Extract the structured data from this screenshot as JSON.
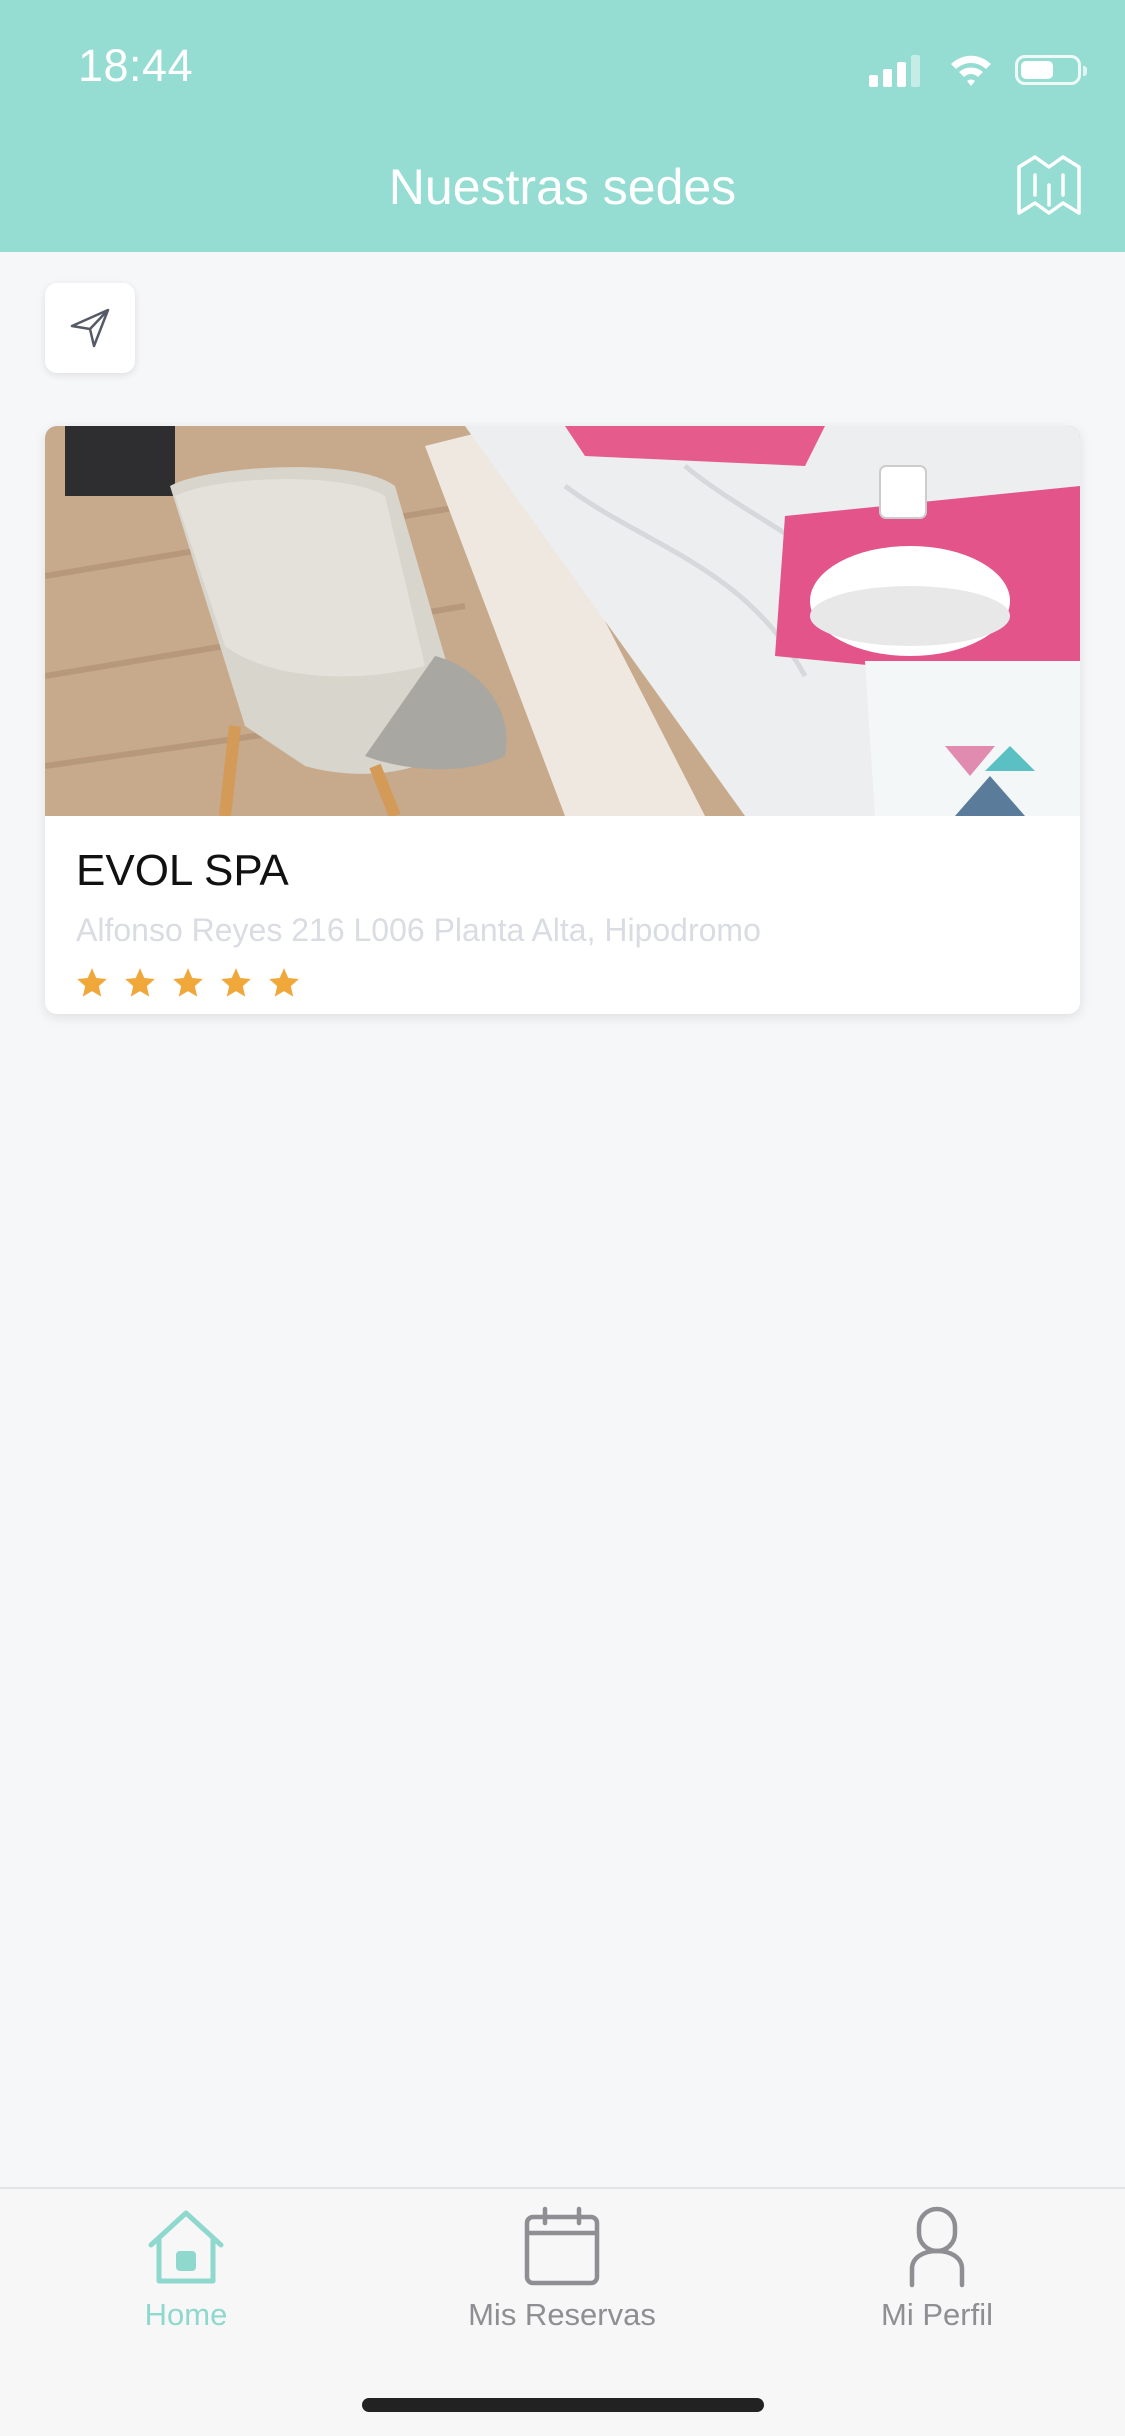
{
  "status_bar": {
    "time": "18:44",
    "battery_level": 0.55
  },
  "header": {
    "title": "Nuestras sedes",
    "map_icon": "map-icon"
  },
  "locate_button": {
    "icon": "navigation-arrow-icon"
  },
  "locations": [
    {
      "name": "EVOL SPA",
      "address": "Alfonso Reyes 216 L006 Planta Alta, Hipodromo",
      "rating": 5,
      "rating_max": 5
    }
  ],
  "tabbar": {
    "tabs": [
      {
        "label": "Home",
        "icon": "home-icon",
        "active": true
      },
      {
        "label": "Mis Reservas",
        "icon": "calendar-icon",
        "active": false
      },
      {
        "label": "Mi Perfil",
        "icon": "profile-icon",
        "active": false
      }
    ]
  },
  "colors": {
    "header_bg": "#95dcd2",
    "page_bg": "#f6f7f9",
    "accent": "#8fd8ce",
    "star": "#f0a83a",
    "inactive_tab": "#8e8e93",
    "address_text": "#d9dce2"
  }
}
